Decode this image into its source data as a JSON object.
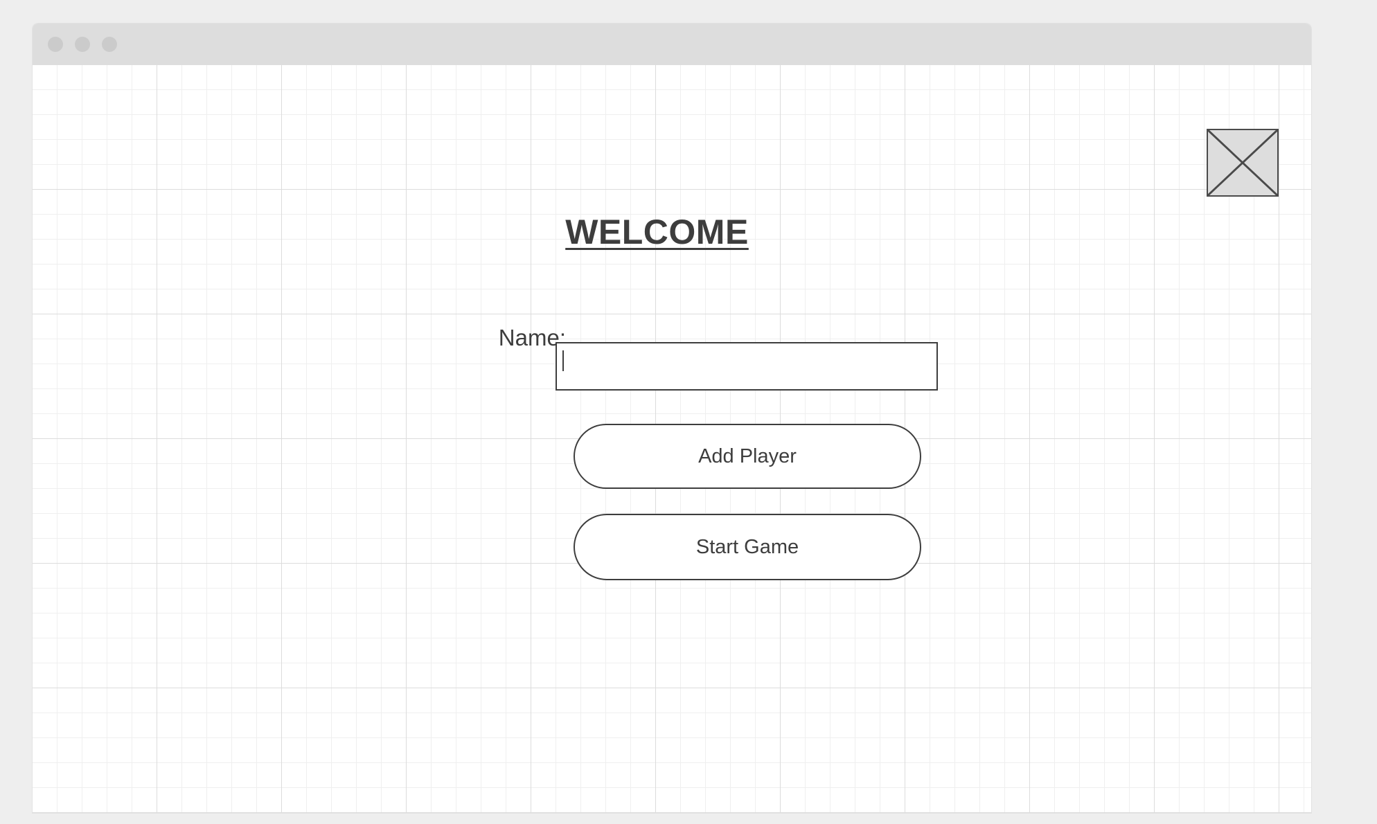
{
  "page": {
    "title": "WELCOME"
  },
  "image_placeholder": {
    "icon": "image-placeholder-icon"
  },
  "form": {
    "name_label": "Name:",
    "name_value": "",
    "name_placeholder": ""
  },
  "buttons": {
    "add_player_label": "Add Player",
    "start_game_label": "Start Game"
  },
  "colors": {
    "background": "#eeeeee",
    "titlebar": "#dddddd",
    "window_dots": "#cbcbcb",
    "ink": "#3d3d3d",
    "grid_major": "#dcdcdc",
    "grid_minor": "#efefef"
  }
}
